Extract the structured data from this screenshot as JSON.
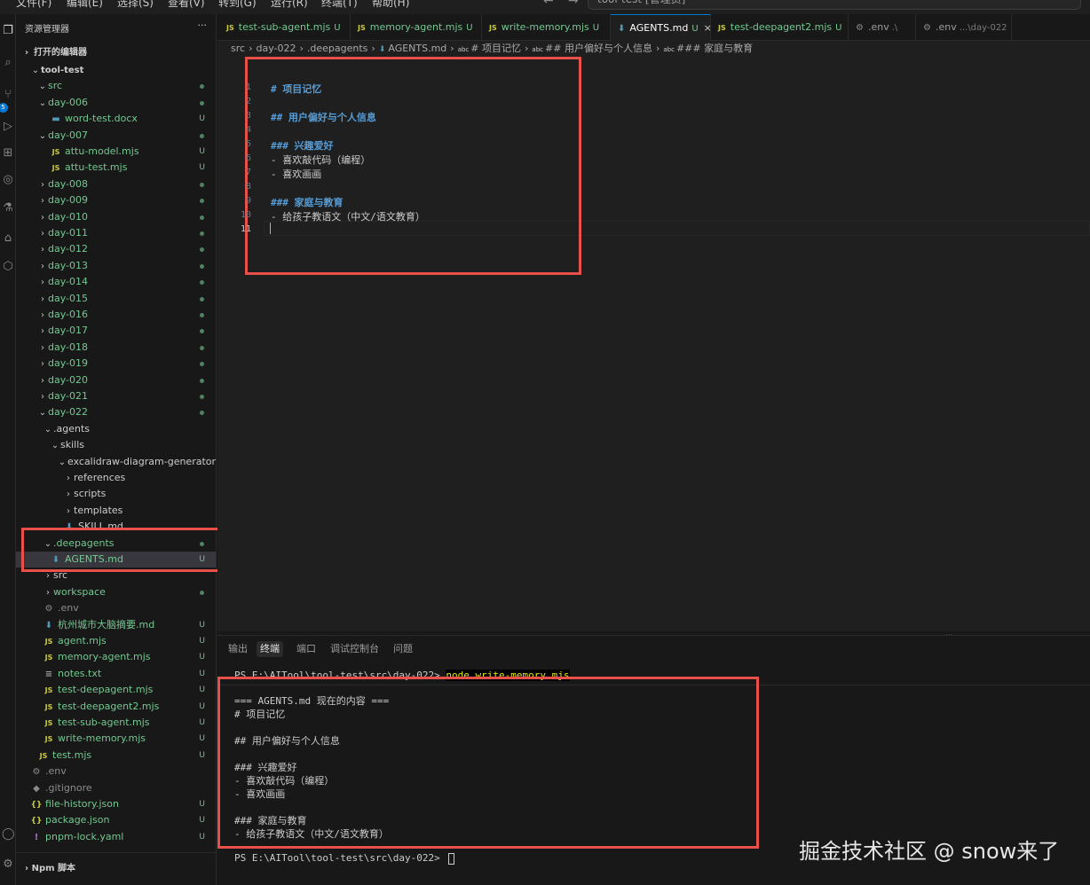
{
  "menubar": {
    "items": [
      "文件(F)",
      "编辑(E)",
      "选择(S)",
      "查看(V)",
      "转到(G)",
      "运行(R)",
      "终端(T)",
      "帮助(H)"
    ],
    "search_text": "tool-test [管理员]",
    "back_icon": "arrow-left-icon",
    "forward_icon": "arrow-right-icon"
  },
  "activity_bar": {
    "icons": [
      "explorer-icon",
      "search-icon",
      "source-control-icon",
      "run-debug-icon",
      "extensions-icon",
      "remote-icon",
      "accounts-icon",
      "settings-icon"
    ],
    "badge": "5"
  },
  "sidebar": {
    "header": "资源管理器",
    "more": "···",
    "open_editors": "打开的编辑器",
    "npm_scripts": "Npm 脚本",
    "tree": [
      {
        "label": "tool-test",
        "type": "root",
        "chev": "v"
      },
      {
        "label": "src",
        "type": "folder",
        "chev": "v",
        "dot": true
      },
      {
        "label": "day-006",
        "type": "folder",
        "chev": "v",
        "dot": true
      },
      {
        "label": "word-test.docx",
        "type": "docx",
        "status": "U"
      },
      {
        "label": "day-007",
        "type": "folder",
        "chev": "v",
        "dot": true
      },
      {
        "label": "attu-model.mjs",
        "type": "js",
        "status": "U"
      },
      {
        "label": "attu-test.mjs",
        "type": "js",
        "status": "U"
      },
      {
        "label": "day-008",
        "type": "folder",
        "chev": ">",
        "dot": true
      },
      {
        "label": "day-009",
        "type": "folder",
        "chev": ">",
        "dot": true
      },
      {
        "label": "day-010",
        "type": "folder",
        "chev": ">",
        "dot": true
      },
      {
        "label": "day-011",
        "type": "folder",
        "chev": ">",
        "dot": true
      },
      {
        "label": "day-012",
        "type": "folder",
        "chev": ">",
        "dot": true
      },
      {
        "label": "day-013",
        "type": "folder",
        "chev": ">",
        "dot": true
      },
      {
        "label": "day-014",
        "type": "folder",
        "chev": ">",
        "dot": true
      },
      {
        "label": "day-015",
        "type": "folder",
        "chev": ">",
        "dot": true
      },
      {
        "label": "day-016",
        "type": "folder",
        "chev": ">",
        "dot": true
      },
      {
        "label": "day-017",
        "type": "folder",
        "chev": ">",
        "dot": true
      },
      {
        "label": "day-018",
        "type": "folder",
        "chev": ">",
        "dot": true
      },
      {
        "label": "day-019",
        "type": "folder",
        "chev": ">",
        "dot": true
      },
      {
        "label": "day-020",
        "type": "folder",
        "chev": ">",
        "dot": true
      },
      {
        "label": "day-021",
        "type": "folder",
        "chev": ">",
        "dot": true
      },
      {
        "label": "day-022",
        "type": "folder",
        "chev": "v",
        "dot": true
      },
      {
        "label": ".agents",
        "type": "folder-plain",
        "chev": "v"
      },
      {
        "label": "skills",
        "type": "folder-plain",
        "chev": "v"
      },
      {
        "label": "excalidraw-diagram-generator",
        "type": "folder-plain",
        "chev": "v"
      },
      {
        "label": "references",
        "type": "folder-plain",
        "chev": ">"
      },
      {
        "label": "scripts",
        "type": "folder-plain",
        "chev": ">"
      },
      {
        "label": "templates",
        "type": "folder-plain",
        "chev": ">"
      },
      {
        "label": "SKILL.md",
        "type": "md-plain"
      },
      {
        "label": ".deepagents",
        "type": "folder",
        "chev": "v",
        "dot": true
      },
      {
        "label": "AGENTS.md",
        "type": "md",
        "status": "U",
        "selected": true
      },
      {
        "label": "src",
        "type": "folder-plain",
        "chev": ">"
      },
      {
        "label": "workspace",
        "type": "folder",
        "chev": ">",
        "dot": true
      },
      {
        "label": ".env",
        "type": "env"
      },
      {
        "label": "杭州城市大脑摘要.md",
        "type": "md",
        "status": "U"
      },
      {
        "label": "agent.mjs",
        "type": "js",
        "status": "U"
      },
      {
        "label": "memory-agent.mjs",
        "type": "js",
        "status": "U"
      },
      {
        "label": "notes.txt",
        "type": "txt",
        "status": "U"
      },
      {
        "label": "test-deepagent.mjs",
        "type": "js",
        "status": "U"
      },
      {
        "label": "test-deepagent2.mjs",
        "type": "js",
        "status": "U"
      },
      {
        "label": "test-sub-agent.mjs",
        "type": "js",
        "status": "U"
      },
      {
        "label": "write-memory.mjs",
        "type": "js",
        "status": "U"
      },
      {
        "label": "test.mjs",
        "type": "js",
        "status": "U"
      },
      {
        "label": ".env",
        "type": "env"
      },
      {
        "label": ".gitignore",
        "type": "git"
      },
      {
        "label": "file-history.json",
        "type": "json",
        "status": "U"
      },
      {
        "label": "package.json",
        "type": "json",
        "status": "U"
      },
      {
        "label": "pnpm-lock.yaml",
        "type": "yaml",
        "status": "U"
      }
    ]
  },
  "tabs": [
    {
      "label": "test-sub-agent.mjs",
      "icon": "JS",
      "status": "U"
    },
    {
      "label": "memory-agent.mjs",
      "icon": "JS",
      "status": "U"
    },
    {
      "label": "write-memory.mjs",
      "icon": "JS",
      "status": "U"
    },
    {
      "label": "AGENTS.md",
      "icon": "md",
      "status": "U",
      "active": true,
      "close": "×"
    },
    {
      "label": "test-deepagent2.mjs",
      "icon": "JS",
      "status": "U"
    },
    {
      "label": ".env",
      "icon": "gear",
      "desc": ".\\"
    },
    {
      "label": ".env",
      "icon": "gear",
      "desc": "...\\day-022"
    }
  ],
  "breadcrumb": [
    "src",
    "day-022",
    ".deepagents",
    "AGENTS.md",
    "# 项目记忆",
    "## 用户偏好与个人信息",
    "### 家庭与教育"
  ],
  "editor": {
    "lines": [
      {
        "n": "1",
        "text": "# 项目记忆",
        "heading": true
      },
      {
        "n": "2",
        "text": ""
      },
      {
        "n": "3",
        "text": "## 用户偏好与个人信息",
        "heading": true
      },
      {
        "n": "4",
        "text": ""
      },
      {
        "n": "5",
        "text": "### 兴趣爱好",
        "heading": true
      },
      {
        "n": "6",
        "text": "- 喜欢敲代码（编程）"
      },
      {
        "n": "7",
        "text": "- 喜欢画画"
      },
      {
        "n": "8",
        "text": ""
      },
      {
        "n": "9",
        "text": "### 家庭与教育",
        "heading": true
      },
      {
        "n": "10",
        "text": "- 给孩子教语文（中文/语文教育）"
      },
      {
        "n": "11",
        "text": ""
      }
    ]
  },
  "panel": {
    "tabs": [
      "输出",
      "终端",
      "端口",
      "调试控制台",
      "问题"
    ],
    "active_tab": "终端",
    "prompt_top": "PS E:\\AITool\\tool-test\\src\\day-022> ",
    "command": "node write-memory.mjs",
    "output": [
      "=== AGENTS.md 现在的内容 ===",
      "# 项目记忆",
      "",
      "## 用户偏好与个人信息",
      "",
      "### 兴趣爱好",
      "- 喜欢敲代码（编程）",
      "- 喜欢画画",
      "",
      "### 家庭与教育",
      "- 给孩子教语文（中文/语文教育）"
    ],
    "prompt_bottom": "PS E:\\AITool\\tool-test\\src\\day-022> "
  },
  "watermark": "掘金技术社区 @ snow来了",
  "colors": {
    "highlight": "#e8504a",
    "accent": "#0078d4",
    "untracked": "#73c991",
    "heading": "#569cd6"
  }
}
